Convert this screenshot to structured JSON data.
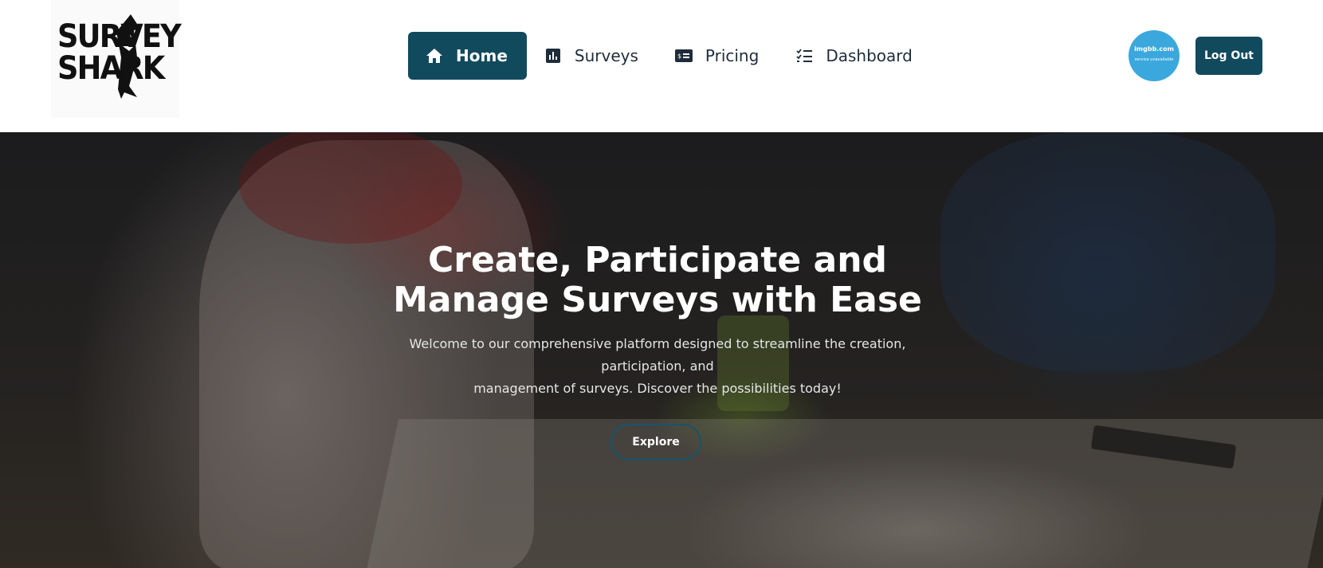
{
  "brand": {
    "logo_line1": "SURVEY",
    "logo_line2": "SHARK",
    "icon": "shark-logo-icon"
  },
  "nav": {
    "items": [
      {
        "label": "Home",
        "icon": "home-icon",
        "active": true
      },
      {
        "label": "Surveys",
        "icon": "bar-chart-icon",
        "active": false
      },
      {
        "label": "Pricing",
        "icon": "money-bill-icon",
        "active": false
      },
      {
        "label": "Dashboard",
        "icon": "checklist-icon",
        "active": false
      }
    ]
  },
  "user": {
    "avatar_text": "imgbb.com",
    "avatar_subtext": "service unavailable",
    "logout_label": "Log Out"
  },
  "hero": {
    "title_line1": "Create, Participate and",
    "title_line2": "Manage Surveys with Ease",
    "subtitle_line1": "Welcome to our comprehensive platform designed to streamline the creation,",
    "subtitle_line2": "participation, and",
    "subtitle_line3": "management of surveys. Discover the possibilities today!",
    "cta_label": "Explore"
  },
  "colors": {
    "primary": "#124a5d",
    "avatar_bg": "#3aa8dc",
    "cta_border": "#14566b"
  }
}
